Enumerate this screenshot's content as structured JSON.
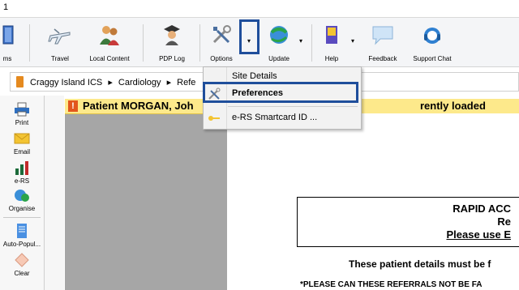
{
  "window": {
    "title": "1"
  },
  "ribbon": {
    "items": [
      {
        "label": "ms",
        "icon": "book-icon"
      },
      {
        "label": "Travel",
        "icon": "airplane-icon"
      },
      {
        "label": "Local Content",
        "icon": "people-icon"
      },
      {
        "label": "PDP Log",
        "icon": "graduate-icon"
      },
      {
        "label": "Options",
        "icon": "tools-icon"
      },
      {
        "label": "Update",
        "icon": "update-globe-icon"
      },
      {
        "label": "Help",
        "icon": "help-book-icon"
      },
      {
        "label": "Feedback",
        "icon": "speech-bubble-icon"
      },
      {
        "label": "Support Chat",
        "icon": "headset-icon"
      }
    ],
    "dropdown_arrow": "▾"
  },
  "breadcrumb": {
    "parts": [
      "Craggy Island ICS",
      "Cardiology",
      "Refe"
    ],
    "separator": "▸"
  },
  "options_menu": {
    "items": [
      {
        "label": "Site Details",
        "icon": ""
      },
      {
        "label": "Preferences",
        "icon": "tools-icon"
      },
      {
        "label": "e-RS Smartcard ID ...",
        "icon": "key-icon"
      }
    ]
  },
  "sidebar": {
    "items": [
      {
        "label": "Print",
        "icon": "printer-icon"
      },
      {
        "label": "Email",
        "icon": "envelope-icon"
      },
      {
        "label": "e-RS",
        "icon": "ers-chart-icon"
      },
      {
        "label": "Organise",
        "icon": "organise-icon"
      },
      {
        "label": "Auto-Popul...",
        "icon": "document-icon"
      },
      {
        "label": "Clear",
        "icon": "eraser-icon"
      }
    ]
  },
  "warning": {
    "bang": "!",
    "text_left": "Patient MORGAN, Joh",
    "text_right": "rently loaded"
  },
  "document": {
    "line1": "RAPID ACC",
    "line2": "Re",
    "line3": "Please use E",
    "line4": "These patient details must be f",
    "line5": "*PLEASE CAN THESE REFERRALS NOT BE FA"
  },
  "colors": {
    "highlight": "#1f4e9b",
    "warning_bg": "#fde98b",
    "accent_orange": "#e58a1f"
  }
}
